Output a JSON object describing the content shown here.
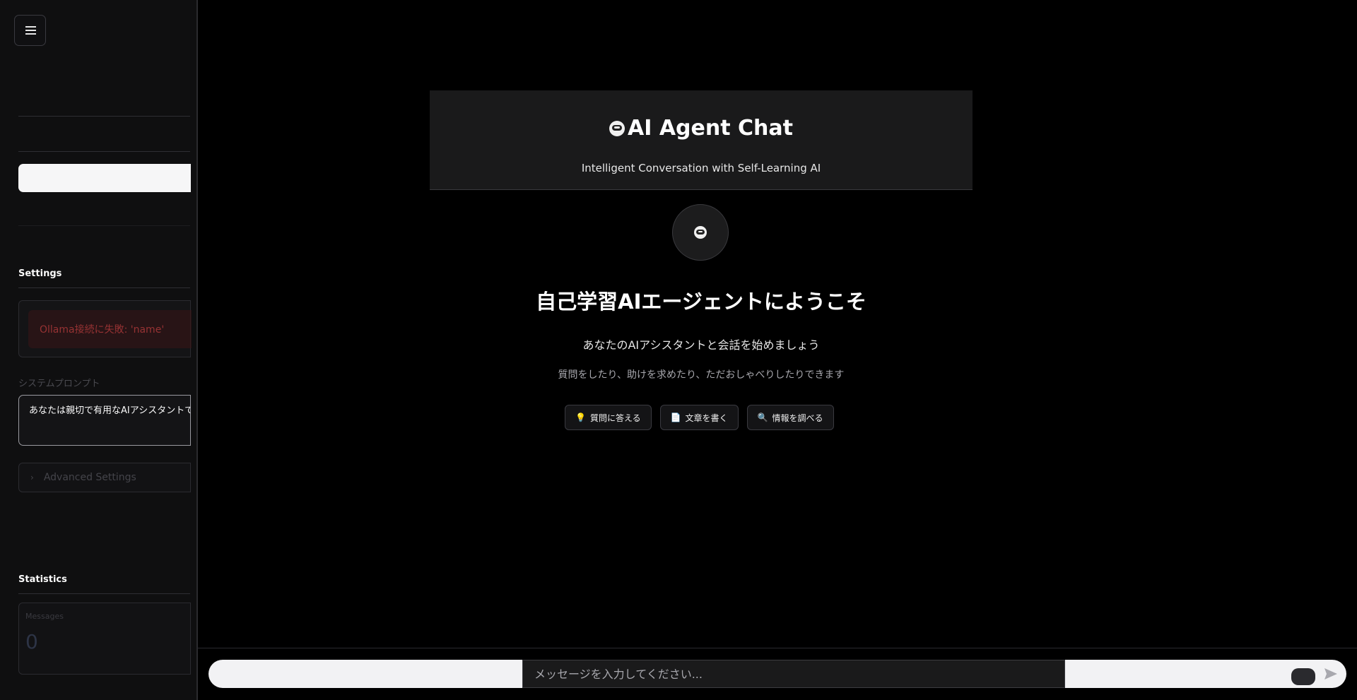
{
  "sidebar": {
    "settings_heading": "Settings",
    "error_message": "Ollama接続に失敗: 'name'",
    "system_prompt_label": "システムプロンプト",
    "system_prompt_value": "あなたは親切で有用なAIアシスタントで",
    "advanced_settings_label": "Advanced Settings",
    "statistics_heading": "Statistics",
    "stats": {
      "label": "Messages",
      "value": "0"
    }
  },
  "header": {
    "title": "AI Agent Chat",
    "subtitle": "Intelligent Conversation with Self-Learning AI",
    "icon": "robot-icon"
  },
  "welcome": {
    "title": "自己学習AIエージェントにようこそ",
    "subtitle": "あなたのAIアシスタントと会話を始めましょう",
    "description": "質問をしたり、助けを求めたり、ただおしゃべりしたりできます"
  },
  "suggestions": [
    {
      "icon": "💡",
      "label": "質問に答える"
    },
    {
      "icon": "📄",
      "label": "文章を書く"
    },
    {
      "icon": "🔍",
      "label": "情報を調べる"
    }
  ],
  "chat": {
    "placeholder": "メッセージを入力してください..."
  },
  "colors": {
    "error": "#ff4b4b",
    "background": "#000000",
    "sidebar": "#0f0f10"
  }
}
